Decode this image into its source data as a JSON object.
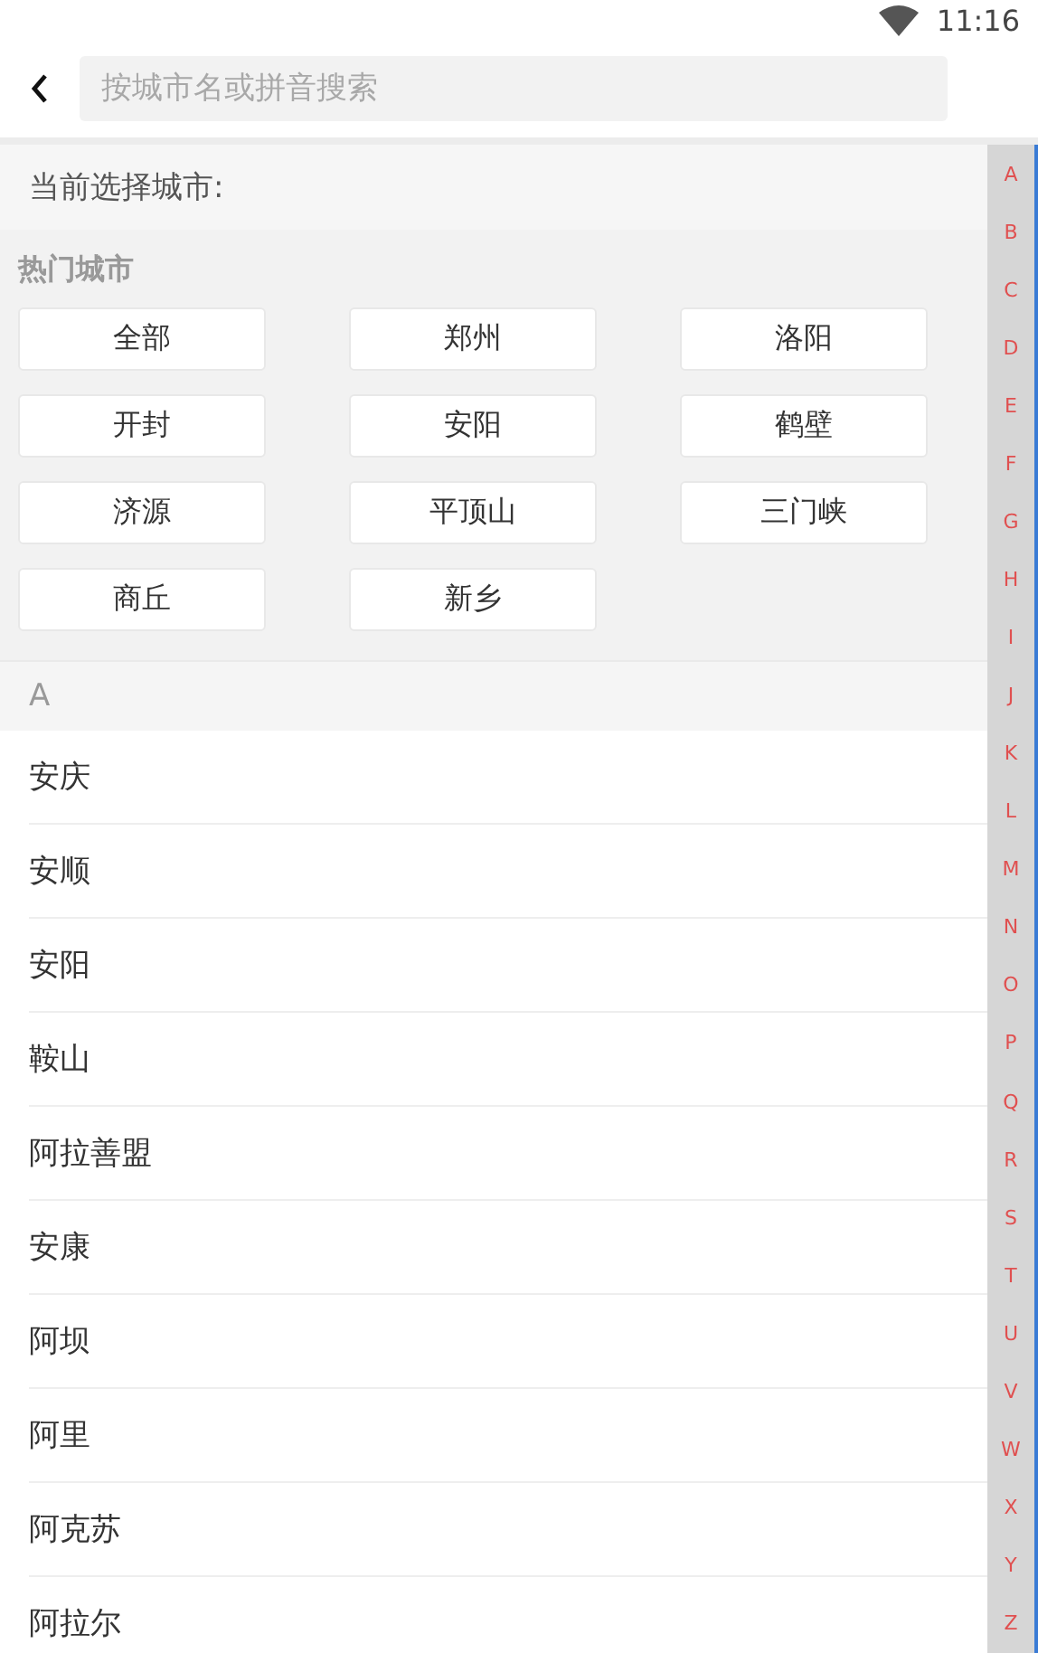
{
  "status_bar": {
    "time": "11:16"
  },
  "search": {
    "placeholder": "按城市名或拼音搜索"
  },
  "current_city": {
    "label": "当前选择城市:"
  },
  "hot_cities": {
    "title": "热门城市",
    "items": [
      "全部",
      "郑州",
      "洛阳",
      "开封",
      "安阳",
      "鹤壁",
      "济源",
      "平顶山",
      "三门峡",
      "商丘",
      "新乡"
    ]
  },
  "sections": [
    {
      "letter": "A",
      "cities": [
        "安庆",
        "安顺",
        "安阳",
        "鞍山",
        "阿拉善盟",
        "安康",
        "阿坝",
        "阿里",
        "阿克苏",
        "阿拉尔"
      ]
    }
  ],
  "index_bar": [
    "A",
    "B",
    "C",
    "D",
    "E",
    "F",
    "G",
    "H",
    "I",
    "J",
    "K",
    "L",
    "M",
    "N",
    "O",
    "P",
    "Q",
    "R",
    "S",
    "T",
    "U",
    "V",
    "W",
    "X",
    "Y",
    "Z"
  ]
}
